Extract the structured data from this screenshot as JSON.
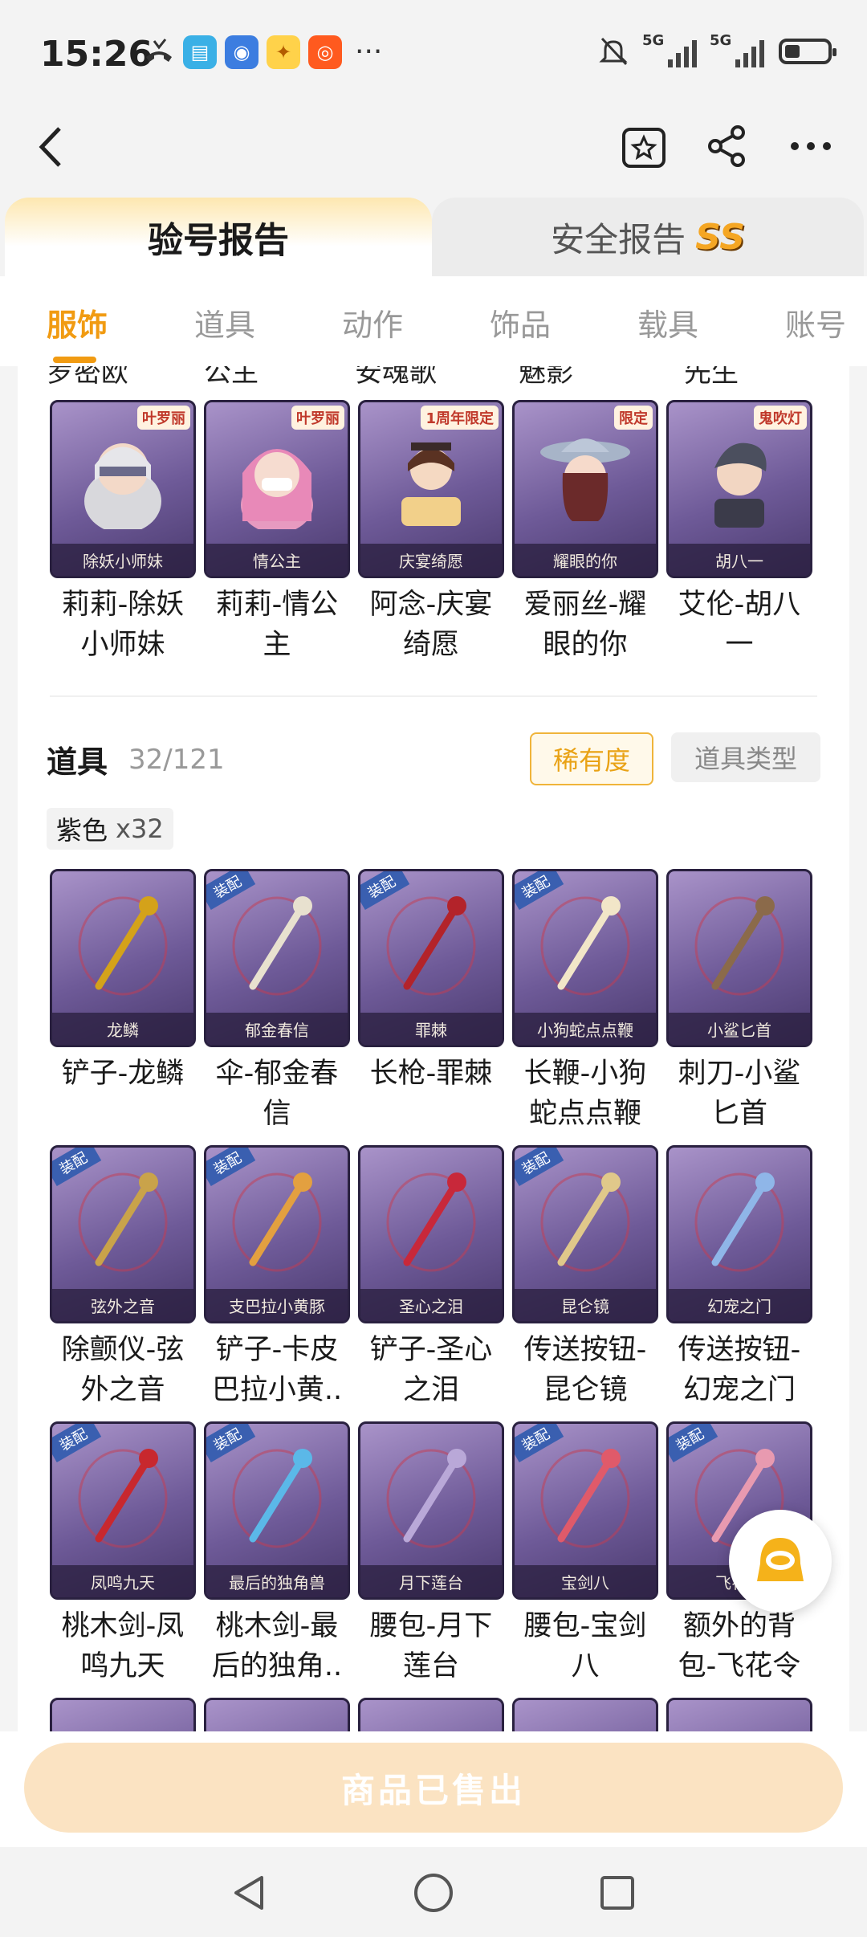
{
  "status": {
    "time": "15:26",
    "signal1": "5G",
    "signal2": "5G",
    "battery_level": 0.35
  },
  "report_tabs": {
    "left": "验号报告",
    "right": "安全报告",
    "right_badge": "SS"
  },
  "categories": [
    {
      "label": "服饰",
      "active": true
    },
    {
      "label": "道具",
      "active": false
    },
    {
      "label": "动作",
      "active": false
    },
    {
      "label": "饰品",
      "active": false
    },
    {
      "label": "载具",
      "active": false
    },
    {
      "label": "账号",
      "active": false
    }
  ],
  "cut_row": [
    "罗密欧",
    "公主",
    "安魂歌",
    "魅影",
    "先生"
  ],
  "outfits": [
    {
      "caption": "除妖小师妹",
      "name": "莉莉-除妖小师妹",
      "tag": "叶罗丽"
    },
    {
      "caption": "情公主",
      "name": "莉莉-情公主",
      "tag": "叶罗丽"
    },
    {
      "caption": "庆宴绮愿",
      "name": "阿念-庆宴绮愿",
      "tag": "1周年限定"
    },
    {
      "caption": "耀眼的你",
      "name": "爱丽丝-耀眼的你",
      "tag": "限定"
    },
    {
      "caption": "胡八一",
      "name": "艾伦-胡八一",
      "tag": "鬼吹灯"
    }
  ],
  "props_section": {
    "title": "道具",
    "count": "32/121",
    "btn_rarity": "稀有度",
    "btn_type": "道具类型",
    "chip_label": "紫色",
    "chip_count": "x32"
  },
  "props": [
    {
      "caption": "龙鳞",
      "name": "铲子-龙鳞",
      "badge": ""
    },
    {
      "caption": "郁金春信",
      "name": "伞-郁金春信",
      "badge": "装配"
    },
    {
      "caption": "罪棘",
      "name": "长枪-罪棘",
      "badge": "装配"
    },
    {
      "caption": "小狗蛇点点鞭",
      "name": "长鞭-小狗蛇点点鞭",
      "badge": "装配"
    },
    {
      "caption": "小鲨匕首",
      "name": "刺刀-小鲨匕首",
      "badge": ""
    },
    {
      "caption": "弦外之音",
      "name": "除颤仪-弦外之音",
      "badge": "装配"
    },
    {
      "caption": "支巴拉小黄豚",
      "name": "铲子-卡皮巴拉小黄..",
      "badge": "装配"
    },
    {
      "caption": "圣心之泪",
      "name": "铲子-圣心之泪",
      "badge": ""
    },
    {
      "caption": "昆仑镜",
      "name": "传送按钮-昆仑镜",
      "badge": "装配"
    },
    {
      "caption": "幻宠之门",
      "name": "传送按钮-幻宠之门",
      "badge": ""
    },
    {
      "caption": "凤鸣九天",
      "name": "桃木剑-凤鸣九天",
      "badge": "装配"
    },
    {
      "caption": "最后的独角兽",
      "name": "桃木剑-最后的独角..",
      "badge": "装配"
    },
    {
      "caption": "月下莲台",
      "name": "腰包-月下莲台",
      "badge": ""
    },
    {
      "caption": "宝剑八",
      "name": "腰包-宝剑八",
      "badge": "装配"
    },
    {
      "caption": "飞花令",
      "name": "额外的背包-飞花令",
      "badge": "装配"
    }
  ],
  "bottom": {
    "sold_label": "商品已售出"
  },
  "colors": {
    "accent": "#f19b12",
    "sold_bg": "#fbe3c2"
  }
}
